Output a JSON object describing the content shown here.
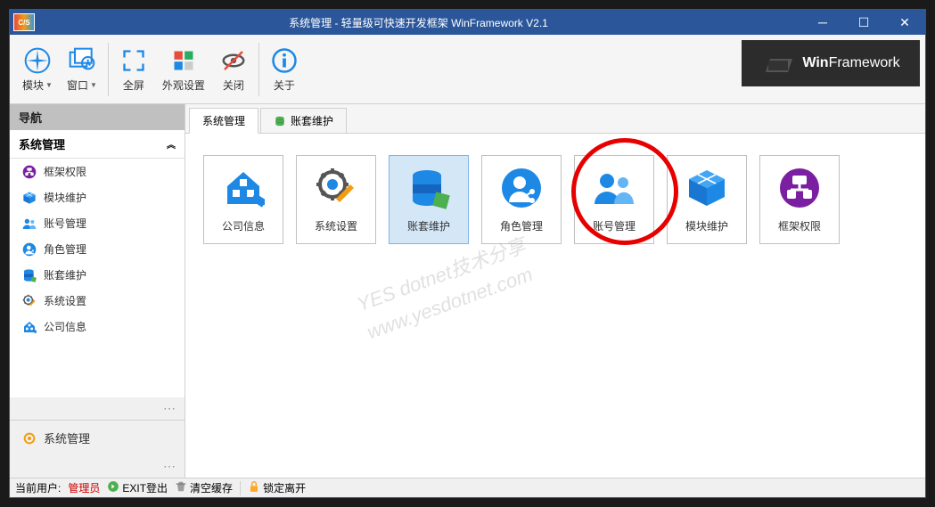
{
  "titlebar": {
    "icon_text": "C/S",
    "title": "系统管理 - 轻量级可快速开发框架 WinFramework V2.1"
  },
  "toolbar": {
    "module": "模块",
    "window": "窗口",
    "fullscreen": "全屏",
    "appearance": "外观设置",
    "close": "关闭",
    "about": "关于",
    "brand_prefix": "Win",
    "brand_suffix": "Framework"
  },
  "sidebar": {
    "nav_title": "导航",
    "section_title": "系统管理",
    "items": [
      {
        "label": "框架权限",
        "icon": "purple-orb"
      },
      {
        "label": "模块维护",
        "icon": "blue-cube"
      },
      {
        "label": "账号管理",
        "icon": "people"
      },
      {
        "label": "角色管理",
        "icon": "person-share"
      },
      {
        "label": "账套维护",
        "icon": "database"
      },
      {
        "label": "系统设置",
        "icon": "gear-pencil"
      },
      {
        "label": "公司信息",
        "icon": "house"
      }
    ],
    "footer_item": "系统管理"
  },
  "tabs": [
    {
      "label": "系统管理",
      "active": true
    },
    {
      "label": "账套维护",
      "active": false
    }
  ],
  "tiles": [
    {
      "label": "公司信息",
      "icon": "house"
    },
    {
      "label": "系统设置",
      "icon": "gear-pencil"
    },
    {
      "label": "账套维护",
      "icon": "database",
      "selected": true
    },
    {
      "label": "角色管理",
      "icon": "person-share"
    },
    {
      "label": "账号管理",
      "icon": "people"
    },
    {
      "label": "模块维护",
      "icon": "blue-cube"
    },
    {
      "label": "框架权限",
      "icon": "purple-orb"
    }
  ],
  "watermark": {
    "line1": "YES dotnet技术分享",
    "line2": "www.yesdotnet.com"
  },
  "statusbar": {
    "current_user_label": "当前用户:",
    "current_user_value": "管理员",
    "exit": "EXIT登出",
    "clear_cache": "清空缓存",
    "lock": "锁定离开"
  },
  "colors": {
    "primary": "#2b579a",
    "accent_blue": "#1e88e5",
    "accent_purple": "#7b1fa2",
    "red_circle": "#e60000"
  }
}
